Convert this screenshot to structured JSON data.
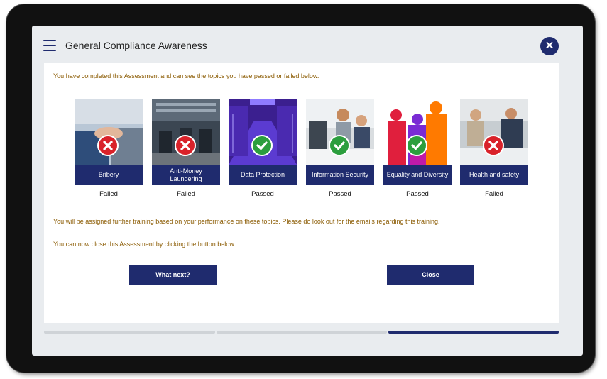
{
  "header": {
    "title": "General Compliance Awareness"
  },
  "content": {
    "intro": "You have completed this Assessment and can see the topics you have passed or failed below.",
    "note1": "You will be assigned further training based on your performance on these topics. Please do look out for the emails regarding this training.",
    "note2": "You can now close this Assessment by clicking the button below."
  },
  "topics": [
    {
      "label": "Bribery",
      "result": "Failed",
      "status": "failed"
    },
    {
      "label": "Anti-Money Laundering",
      "result": "Failed",
      "status": "failed"
    },
    {
      "label": "Data Protection",
      "result": "Passed",
      "status": "passed"
    },
    {
      "label": "Information Security",
      "result": "Passed",
      "status": "passed"
    },
    {
      "label": "Equality and Diversity",
      "result": "Passed",
      "status": "passed"
    },
    {
      "label": "Health and safety",
      "result": "Failed",
      "status": "failed"
    }
  ],
  "buttons": {
    "next": "What next?",
    "close": "Close"
  },
  "progress": {
    "total_steps": 3,
    "current_step": 3
  },
  "colors": {
    "navy": "#1f2b6e",
    "fail": "#d9222a",
    "pass": "#2c9e3e",
    "note_text": "#8a5a00"
  }
}
